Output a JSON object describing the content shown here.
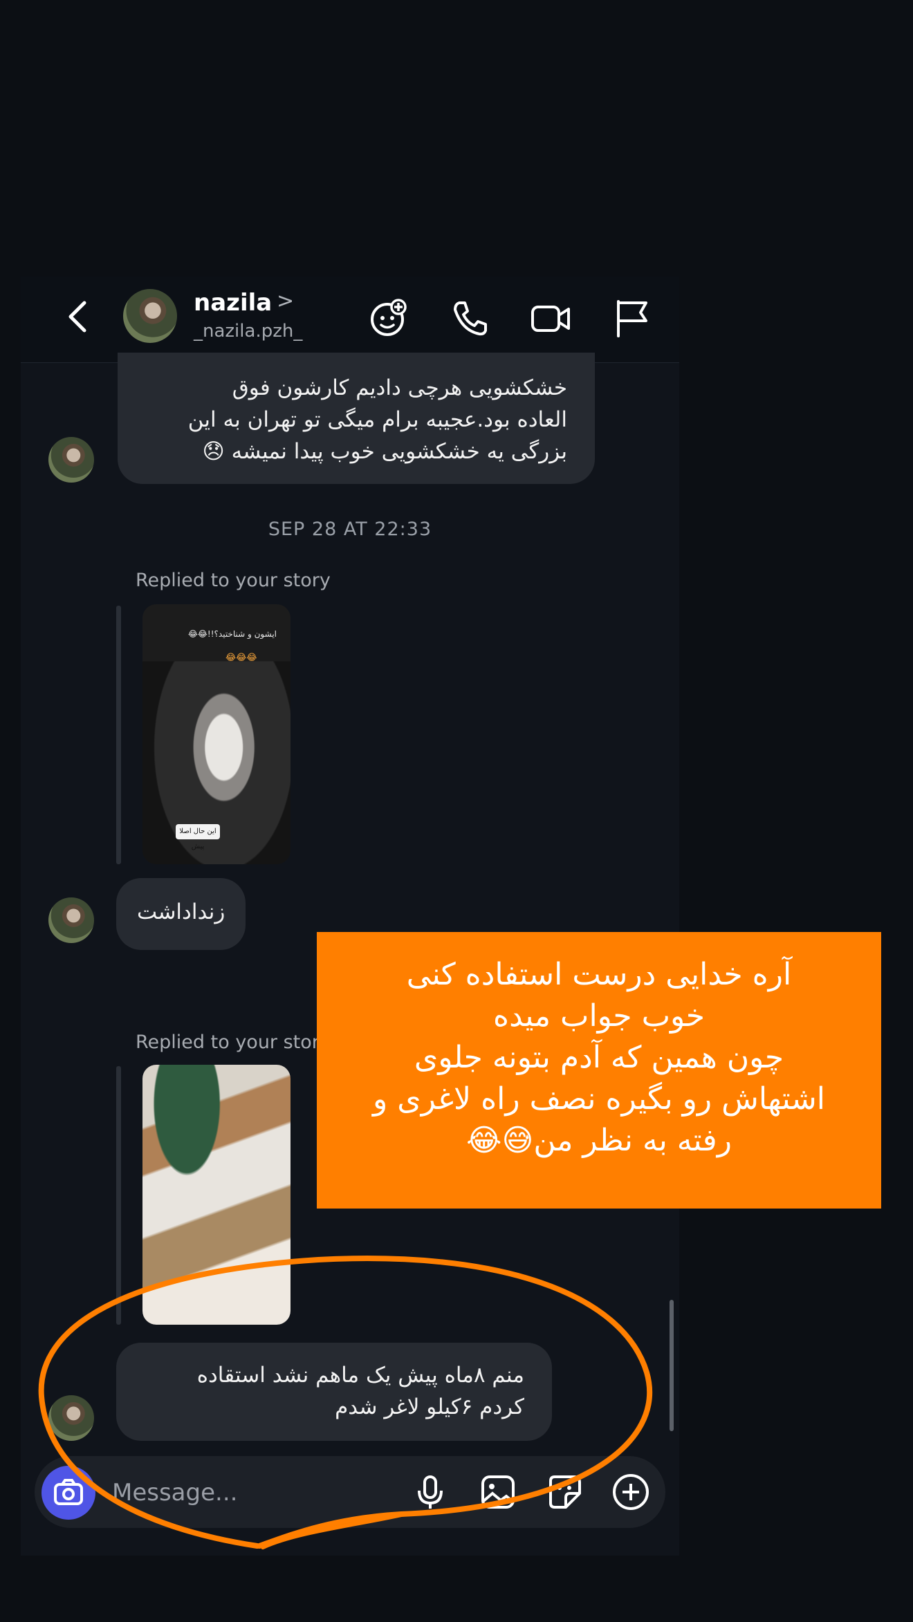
{
  "header": {
    "name": "nazila",
    "handle": "_nazila.pzh_",
    "chevron": ">"
  },
  "messages": {
    "first": "خشکشویی هرچی دادیم کارشون فوق\nالعاده بود.عجیبه برام میگی تو تهران به این\nبزرگی یه خشکشویی خوب پیدا نمیشه 😞",
    "timestamp": "SEP 28 AT 22:33",
    "replied1": "Replied to your story",
    "story1_caption": "ایشون و شناختید؟!!😂😂",
    "story1_emoji": "😂😂😂",
    "story1_tag": "این حال اصلا پیش",
    "reply_text": "زنداداشت",
    "replied2": "Replied to your story",
    "last": "منم ۸ماه پیش یک ماهم نشد استقاده\nکردم ۶کیلو لاغر شدم"
  },
  "composer": {
    "placeholder": "Message..."
  },
  "overlay": {
    "text": "آره خدایی درست استفاده کنی\nخوب جواب میده\nچون همین که آدم بتونه جلوی\nاشتهاش رو بگیره نصف راه لاغری و\nرفته به نظر من😅😂"
  },
  "colors": {
    "overlay": "#ff7f00",
    "bubble": "#262a31",
    "camera": "#4f55e6",
    "background": "#10141b"
  }
}
